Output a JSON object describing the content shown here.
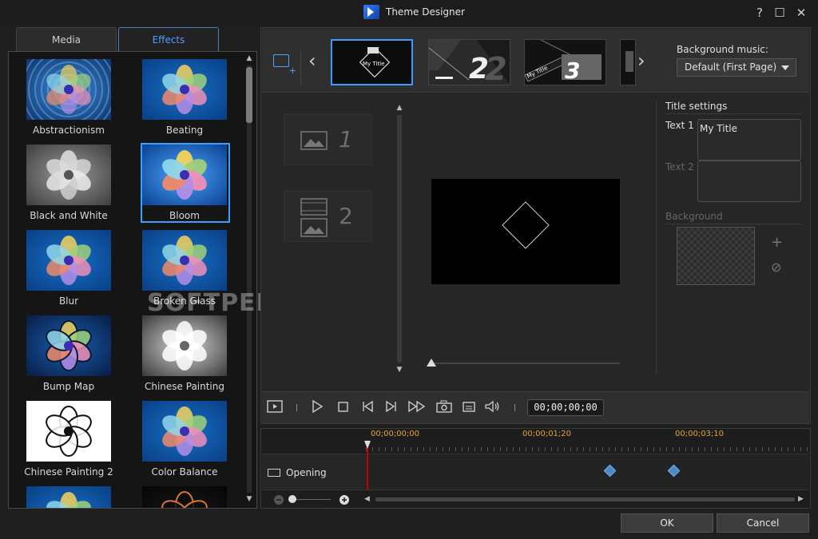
{
  "window": {
    "title": "Theme Designer",
    "controls": {
      "help": "?",
      "maximize": "☐",
      "close": "✕"
    }
  },
  "left_panel": {
    "tabs": [
      {
        "label": "Media",
        "active": false
      },
      {
        "label": "Effects",
        "active": true
      }
    ],
    "effects": [
      {
        "label": "Abstractionism",
        "style": "abstract"
      },
      {
        "label": "Beating",
        "style": "blue"
      },
      {
        "label": "Black and White",
        "style": "gray"
      },
      {
        "label": "Bloom",
        "style": "bloom",
        "selected": true
      },
      {
        "label": "Blur",
        "style": "blue"
      },
      {
        "label": "Broken Glass",
        "style": "blue"
      },
      {
        "label": "Bump Map",
        "style": "bump"
      },
      {
        "label": "Chinese Painting",
        "style": "white"
      },
      {
        "label": "Chinese Painting 2",
        "style": "ink"
      },
      {
        "label": "Color Balance",
        "style": "blue"
      },
      {
        "label": "",
        "style": "blue"
      },
      {
        "label": "",
        "style": "dark"
      }
    ]
  },
  "scenes": {
    "slides": [
      {
        "number": "",
        "caption": "My Title"
      },
      {
        "number": "2",
        "caption": ""
      },
      {
        "number": "3",
        "caption": "My Title"
      }
    ],
    "background_music": {
      "label": "Background music:",
      "selected": "Default (First Page)"
    }
  },
  "objects": [
    {
      "number": "1"
    },
    {
      "number": "2"
    }
  ],
  "title_settings": {
    "heading": "Title settings",
    "text1_label": "Text 1",
    "text1_value": "My Title",
    "text2_label": "Text 2",
    "text2_value": "",
    "background_label": "Background",
    "add_icon": "+",
    "remove_icon": "⊘"
  },
  "transport": {
    "timecode": "00;00;00;00"
  },
  "timeline": {
    "ruler_labels": [
      "00;00;00;00",
      "00;00;01;20",
      "00;00;03;10"
    ],
    "track_name": "Opening"
  },
  "buttons": {
    "ok": "OK",
    "cancel": "Cancel"
  },
  "watermark": "SOFTPEDIA",
  "colors": {
    "accent": "#3a9aff",
    "timecode_orange": "#e5a23b",
    "keyframe": "#4a8ac8"
  }
}
